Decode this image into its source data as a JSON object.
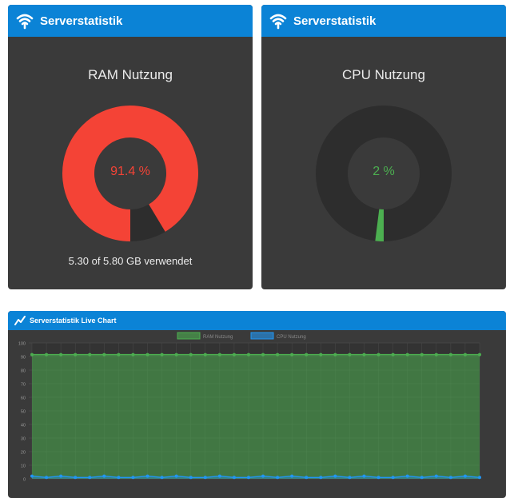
{
  "ram_panel": {
    "header_title": "Serverstatistik",
    "header_icon": "wifi-icon",
    "title": "RAM Nutzung",
    "value_text": "91.4 %",
    "percent": 91.4,
    "footer": "5.30 of 5.80 GB verwendet",
    "fill_color": "#f44336",
    "track_color": "#2d2d2d"
  },
  "cpu_panel": {
    "header_title": "Serverstatistik",
    "header_icon": "wifi-icon",
    "title": "CPU Nutzung",
    "value_text": "2 %",
    "percent": 2,
    "fill_color": "#4caf50",
    "track_color": "#2d2d2d"
  },
  "chart_panel": {
    "header_title": "Serverstatistik Live Chart",
    "header_icon": "line-chart-icon"
  },
  "chart_data": {
    "type": "area",
    "legend_position": "top-center",
    "grid": true,
    "ylim": [
      0,
      100
    ],
    "y_ticks": [
      0,
      10,
      20,
      30,
      40,
      50,
      60,
      70,
      80,
      90,
      100
    ],
    "series": [
      {
        "name": "RAM Nutzung",
        "color": "#4caf50",
        "values": [
          91.4,
          91.4,
          91.4,
          91.4,
          91.4,
          91.4,
          91.4,
          91.4,
          91.4,
          91.4,
          91.4,
          91.4,
          91.4,
          91.4,
          91.4,
          91.4,
          91.4,
          91.4,
          91.4,
          91.4,
          91.4,
          91.4,
          91.4,
          91.4,
          91.4,
          91.4,
          91.4,
          91.4,
          91.4,
          91.4,
          91.4,
          91.4
        ]
      },
      {
        "name": "CPU Nutzung",
        "color": "#2196f3",
        "values": [
          2,
          1,
          2,
          1,
          1,
          2,
          1,
          1,
          2,
          1,
          2,
          1,
          1,
          2,
          1,
          1,
          2,
          1,
          2,
          1,
          1,
          2,
          1,
          2,
          1,
          1,
          2,
          1,
          2,
          1,
          2,
          1
        ]
      }
    ]
  },
  "colors": {
    "header_blue": "#0b83d6",
    "panel_bg": "#3a3a3a"
  }
}
